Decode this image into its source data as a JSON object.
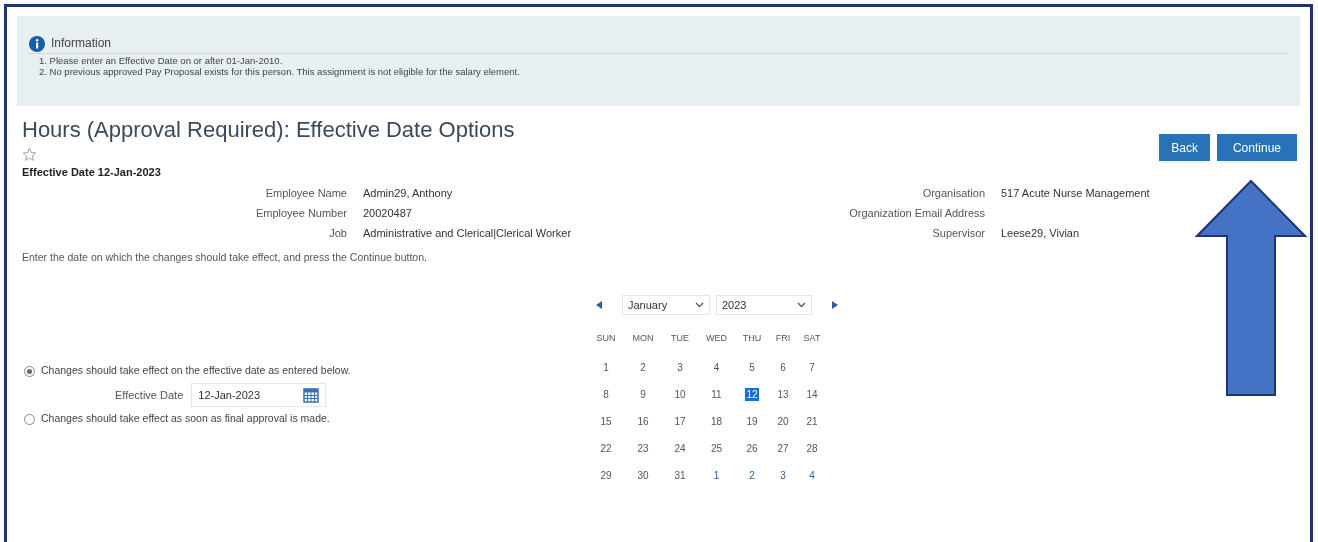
{
  "information": {
    "title": "Information",
    "messages": [
      "1. Please enter an Effective Date on or after 01-Jan-2010.",
      "2. No previous approved Pay Proposal exists for this person. This assignment is not eligible for the salary element."
    ]
  },
  "page_title": "Hours (Approval Required): Effective Date Options",
  "favorite": {
    "on": false
  },
  "effective_date_line": "Effective Date 12-Jan-2023",
  "buttons": [
    {
      "label": "Back",
      "kind": "secondary"
    },
    {
      "label": "Continue",
      "kind": "primary"
    }
  ],
  "details_left": [
    {
      "label": "Employee Name",
      "value": "Admin29, Anthony"
    },
    {
      "label": "Employee Number",
      "value": "20020487"
    },
    {
      "label": "Job",
      "value": "Administrative and Clerical|Clerical Worker"
    }
  ],
  "details_right": [
    {
      "label": "Organisation",
      "value": "517 Acute Nurse Management"
    },
    {
      "label": "Organization Email Address"
    },
    {
      "label": "Supervisor",
      "value": "Leese29, Vivian"
    }
  ],
  "instruction": "Enter the date on which the changes should take effect, and press the Continue button.",
  "options": [
    {
      "label": "Changes should take effect on the effective date as entered below.",
      "selected": true,
      "field": {
        "label": "Effective Date",
        "value": "12-Jan-2023"
      }
    },
    {
      "label": "Changes should take effect as soon as final approval is made.",
      "selected": false
    }
  ],
  "calendar": {
    "month": "January",
    "year": "2023",
    "weekdays": [
      "SUN",
      "MON",
      "TUE",
      "WED",
      "THU",
      "FRI",
      "SAT"
    ],
    "weeks": [
      [
        {
          "day": "1",
          "selected": false,
          "other_month": false
        },
        {
          "day": "2",
          "selected": false,
          "other_month": false
        },
        {
          "day": "3",
          "selected": false,
          "other_month": false
        },
        {
          "day": "4",
          "selected": false,
          "other_month": false
        },
        {
          "day": "5",
          "selected": false,
          "other_month": false
        },
        {
          "day": "6",
          "selected": false,
          "other_month": false
        },
        {
          "day": "7",
          "selected": false,
          "other_month": false
        }
      ],
      [
        {
          "day": "8",
          "selected": false,
          "other_month": false
        },
        {
          "day": "9",
          "selected": false,
          "other_month": false
        },
        {
          "day": "10",
          "selected": false,
          "other_month": false
        },
        {
          "day": "11",
          "selected": false,
          "other_month": false
        },
        {
          "day": "12",
          "selected": true,
          "other_month": false
        },
        {
          "day": "13",
          "selected": false,
          "other_month": false
        },
        {
          "day": "14",
          "selected": false,
          "other_month": false
        }
      ],
      [
        {
          "day": "15",
          "selected": false,
          "other_month": false
        },
        {
          "day": "16",
          "selected": false,
          "other_month": false
        },
        {
          "day": "17",
          "selected": false,
          "other_month": false
        },
        {
          "day": "18",
          "selected": false,
          "other_month": false
        },
        {
          "day": "19",
          "selected": false,
          "other_month": false
        },
        {
          "day": "20",
          "selected": false,
          "other_month": false
        },
        {
          "day": "21",
          "selected": false,
          "other_month": false
        }
      ],
      [
        {
          "day": "22",
          "selected": false,
          "other_month": false
        },
        {
          "day": "23",
          "selected": false,
          "other_month": false
        },
        {
          "day": "24",
          "selected": false,
          "other_month": false
        },
        {
          "day": "25",
          "selected": false,
          "other_month": false
        },
        {
          "day": "26",
          "selected": false,
          "other_month": false
        },
        {
          "day": "27",
          "selected": false,
          "other_month": false
        },
        {
          "day": "28",
          "selected": false,
          "other_month": false
        }
      ],
      [
        {
          "day": "29",
          "selected": false,
          "other_month": false
        },
        {
          "day": "30",
          "selected": false,
          "other_month": false
        },
        {
          "day": "31",
          "selected": false,
          "other_month": false
        },
        {
          "day": "1",
          "selected": false,
          "other_month": true
        },
        {
          "day": "2",
          "selected": false,
          "other_month": true
        },
        {
          "day": "3",
          "selected": false,
          "other_month": true
        },
        {
          "day": "4",
          "selected": false,
          "other_month": true
        }
      ]
    ]
  }
}
